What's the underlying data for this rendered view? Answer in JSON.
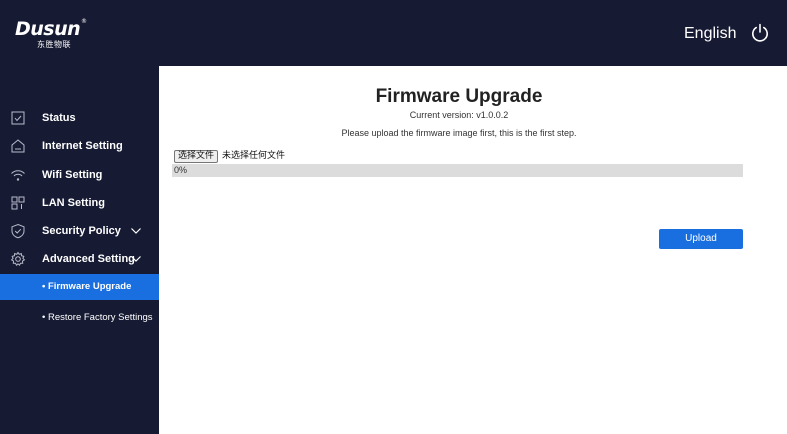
{
  "header": {
    "logo_text": "Dusun",
    "logo_subtext": "东胜物联",
    "logo_mark": "®",
    "language": "English"
  },
  "sidebar": {
    "items": [
      {
        "label": "Status",
        "icon": "status-icon"
      },
      {
        "label": "Internet Setting",
        "icon": "internet-icon"
      },
      {
        "label": "Wifi Setting",
        "icon": "wifi-icon"
      },
      {
        "label": "LAN Setting",
        "icon": "lan-icon"
      },
      {
        "label": "Security Policy",
        "icon": "shield-icon"
      },
      {
        "label": "Advanced Setting",
        "icon": "gear-icon"
      }
    ],
    "subitems": [
      {
        "label": "• Firmware Upgrade",
        "active": true
      },
      {
        "label": "• Restore Factory Settings",
        "active": false
      }
    ]
  },
  "main": {
    "title": "Firmware Upgrade",
    "version": "Current version:  v1.0.0.2",
    "hint": "Please upload the firmware image first, this is the first step.",
    "file_button": "选择文件",
    "file_status": "未选择任何文件",
    "progress_text": "0%",
    "progress_value": 0,
    "upload_label": "Upload"
  },
  "colors": {
    "nav_bg": "#161a33",
    "accent": "#1a6fe0",
    "progress_bg": "#dcdcdc"
  }
}
